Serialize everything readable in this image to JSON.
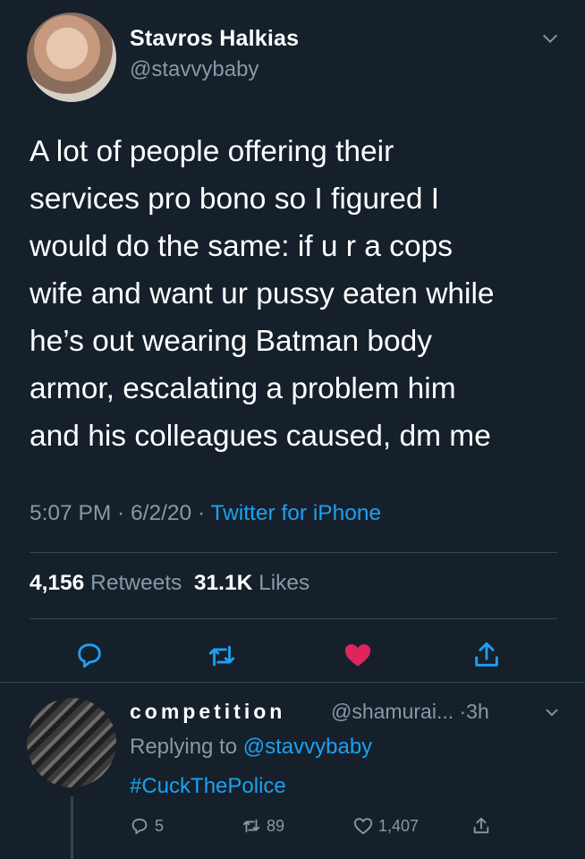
{
  "tweet": {
    "display_name": "Stavros Halkias",
    "handle": "@stavvybaby",
    "text": "A lot of people offering their\nservices pro bono so I figured I\nwould do the same: if u r a cops\nwife and want ur pussy eaten while\nhe’s out wearing Batman body\narmor, escalating a problem him\nand his colleagues caused, dm me",
    "time": "5:07 PM",
    "date": "6/2/20",
    "source": "Twitter for iPhone",
    "separator": " · ",
    "retweets_count": "4,156",
    "retweets_label": "Retweets",
    "likes_count": "31.1K",
    "likes_label": "Likes"
  },
  "reply": {
    "display_name": "competition",
    "handle_time": "@shamurai... ·3h",
    "replying_prefix": "Replying to",
    "replying_handle": "@stavvybaby",
    "text": "#CuckThePolice",
    "reply_count": "5",
    "retweet_count": "89",
    "like_count": "1,407"
  },
  "colors": {
    "background": "#15202b",
    "secondary_text": "#8899a6",
    "accent": "#1da1f2",
    "like": "#e0245e",
    "divider": "#38444d"
  },
  "icons": [
    "chevron-down-icon",
    "reply-icon",
    "retweet-icon",
    "heart-icon",
    "share-icon"
  ]
}
